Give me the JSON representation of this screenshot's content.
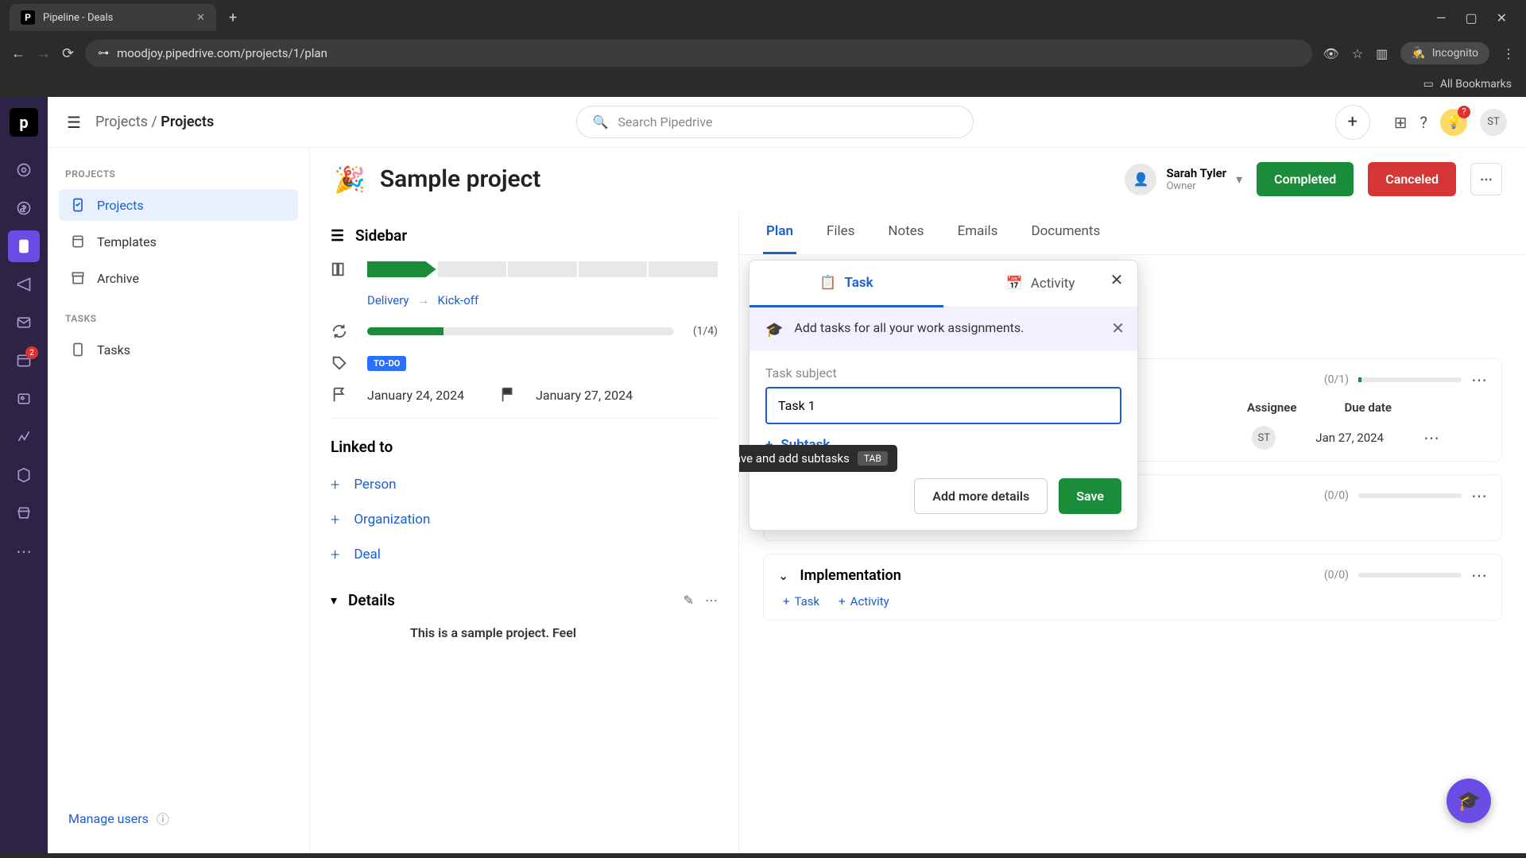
{
  "browser": {
    "tab_title": "Pipeline - Deals",
    "url": "moodjoy.pipedrive.com/projects/1/plan",
    "incognito": "Incognito",
    "all_bookmarks": "All Bookmarks"
  },
  "topbar": {
    "breadcrumb_root": "Projects",
    "breadcrumb_current": "Projects",
    "search_placeholder": "Search Pipedrive",
    "user_initials": "ST"
  },
  "rail": {
    "mail_badge": "2"
  },
  "sidebar": {
    "projects_header": "PROJECTS",
    "items": [
      {
        "label": "Projects"
      },
      {
        "label": "Templates"
      },
      {
        "label": "Archive"
      }
    ],
    "tasks_header": "TASKS",
    "task_items": [
      {
        "label": "Tasks"
      }
    ],
    "manage_users": "Manage users"
  },
  "project": {
    "emoji": "🎉",
    "title": "Sample project",
    "owner_name": "Sarah Tyler",
    "owner_role": "Owner",
    "completed_btn": "Completed",
    "canceled_btn": "Canceled"
  },
  "left": {
    "sidebar_label": "Sidebar",
    "stage1": "Delivery",
    "stage2": "Kick-off",
    "progress_count": "(1/4)",
    "tag": "TO-DO",
    "start_date": "January 24, 2024",
    "end_date": "January 27, 2024",
    "linked_to": "Linked to",
    "link_person": "Person",
    "link_org": "Organization",
    "link_deal": "Deal",
    "details": "Details",
    "desc_preview": "This is a sample project. Feel"
  },
  "tabs": {
    "plan": "Plan",
    "files": "Files",
    "notes": "Notes",
    "emails": "Emails",
    "documents": "Documents"
  },
  "popup": {
    "tab_task": "Task",
    "tab_activity": "Activity",
    "hint": "Add tasks for all your work assignments.",
    "field_label": "Task subject",
    "input_value": "Task 1",
    "subtask": "Subtask",
    "add_details": "Add more details",
    "save": "Save",
    "tooltip": "Save and add subtasks",
    "tooltip_key": "TAB"
  },
  "phases": {
    "kickoff_count": "(0/1)",
    "col_assignee": "Assignee",
    "col_due": "Due date",
    "assignee": "ST",
    "due": "Jan 27, 2024",
    "mid_count": "(0/0)",
    "task_action": "Task",
    "activity_action": "Activity",
    "impl_name": "Implementation",
    "impl_count": "(0/0)"
  }
}
